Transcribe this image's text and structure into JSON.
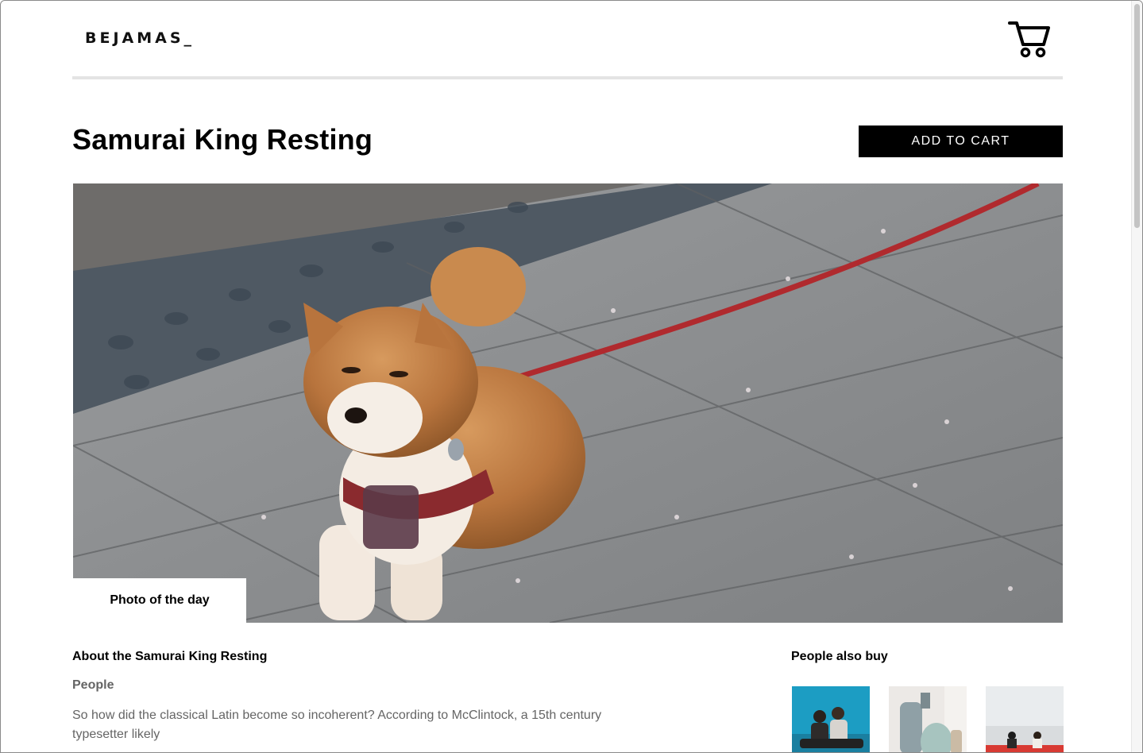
{
  "header": {
    "logo_text": "BEJAMAS_",
    "cart_icon": "shopping-cart-icon"
  },
  "product": {
    "title": "Samurai King Resting",
    "add_to_cart_label": "ADD TO CART",
    "badge_label": "Photo of the day",
    "image_icon": "shiba-dog-photo"
  },
  "about": {
    "title": "About the Samurai King Resting",
    "category": "People",
    "description": "So how did the classical Latin become so incoherent? According to McClintock, a 15th century typesetter likely"
  },
  "also_buy": {
    "title": "People also buy",
    "items": [
      {
        "icon": "people-on-blue-photo"
      },
      {
        "icon": "vases-photo"
      },
      {
        "icon": "couple-on-red-bench-photo"
      }
    ]
  },
  "colors": {
    "accent": "#000000",
    "muted_text": "#656565",
    "divider": "#e4e4e4"
  }
}
